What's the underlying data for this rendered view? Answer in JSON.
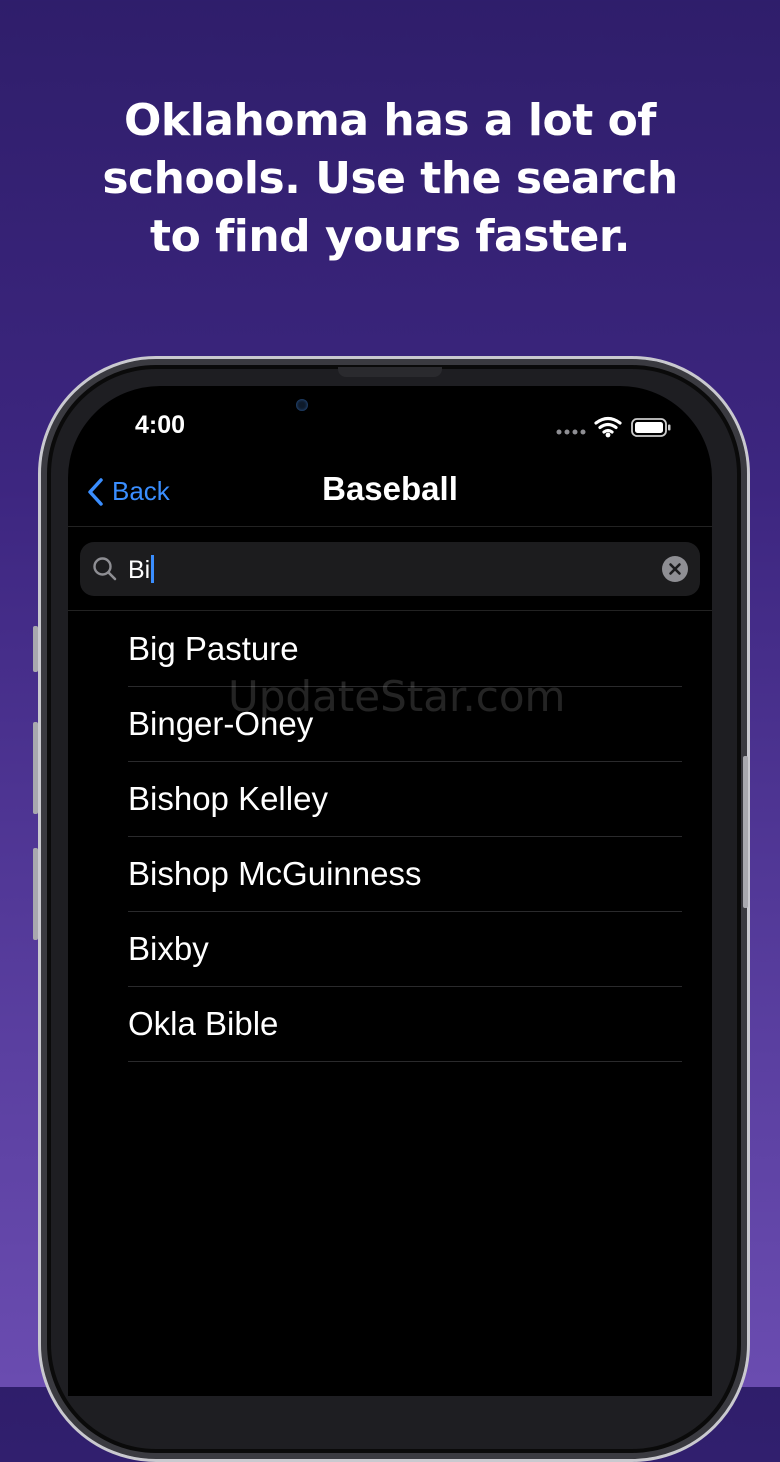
{
  "headline": {
    "line1": "Oklahoma has a lot of",
    "line2": "schools. Use the search",
    "line3": "to find yours faster."
  },
  "status_bar": {
    "time": "4:00",
    "icons": [
      "signal-dots-icon",
      "wifi-icon",
      "battery-icon"
    ]
  },
  "nav": {
    "back_label": "Back",
    "title": "Baseball"
  },
  "search": {
    "value": "Bi"
  },
  "results": [
    {
      "label": "Big Pasture"
    },
    {
      "label": "Binger-Oney"
    },
    {
      "label": "Bishop Kelley"
    },
    {
      "label": "Bishop McGuinness"
    },
    {
      "label": "Bixby"
    },
    {
      "label": "Okla Bible"
    }
  ],
  "watermark": "UpdateStar.com",
  "colors": {
    "accent": "#3a8eff",
    "background": "#3d2680",
    "screen": "#000000"
  }
}
